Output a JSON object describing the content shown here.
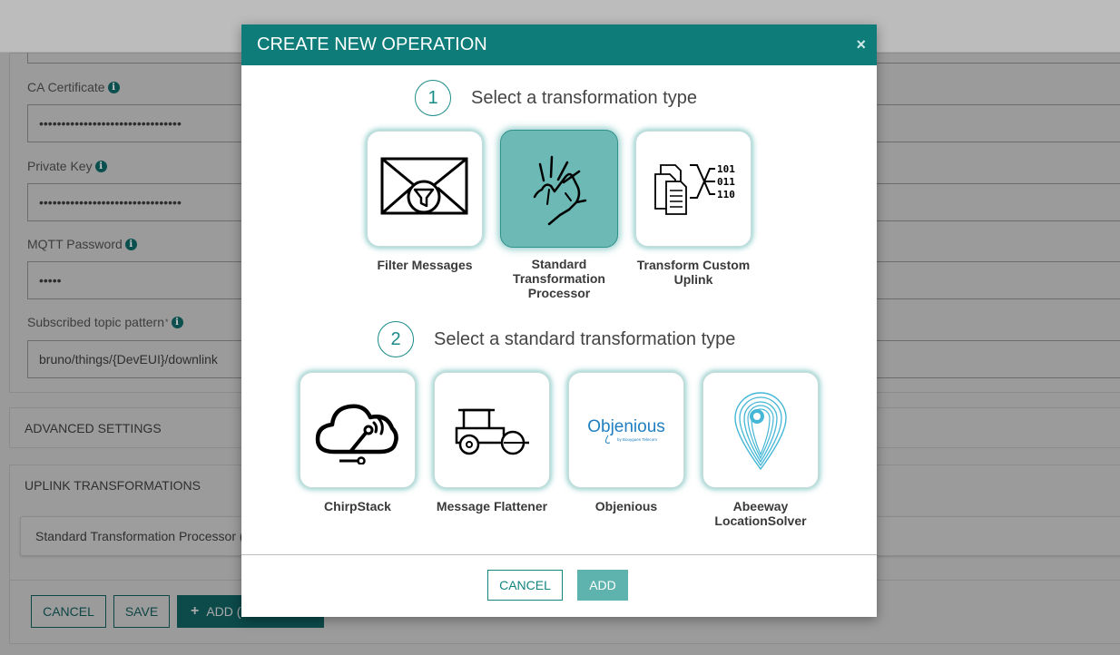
{
  "background": {
    "fields": [
      {
        "label": "CA Certificate",
        "value": "••••••••••••••••••••••••••••••••",
        "required": false
      },
      {
        "label": "Private Key",
        "value": "••••••••••••••••••••••••••••••••",
        "required": false
      },
      {
        "label": "MQTT Password",
        "value": "•••••",
        "required": false
      },
      {
        "label": "Subscribed topic pattern",
        "value": "bruno/things/{DevEUI}/downlink",
        "required": true
      }
    ],
    "required_marker": "*",
    "info_icon": "i",
    "advanced_settings": "ADVANCED SETTINGS",
    "uplink_transformations": "UPLINK TRANSFORMATIONS",
    "processor_card": "Standard Transformation Processor (",
    "buttons": {
      "cancel": "CANCEL",
      "save": "SAVE",
      "add": "ADD (",
      "add_icon": "+"
    }
  },
  "modal": {
    "title": "CREATE NEW OPERATION",
    "close": "×",
    "step1": {
      "number": "1",
      "text": "Select a transformation type"
    },
    "transformation_types": [
      {
        "label": "Filter Messages",
        "icon": "envelope-filter-icon",
        "selected": false
      },
      {
        "label": "Standard Transformation Processor",
        "icon": "finger-tap-icon",
        "selected": true
      },
      {
        "label": "Transform Custom Uplink",
        "icon": "documents-binary-icon",
        "selected": false
      }
    ],
    "binary_lines": [
      "101",
      "011",
      "110"
    ],
    "step2": {
      "number": "2",
      "text": "Select a standard transformation type"
    },
    "standard_types": [
      {
        "label": "ChirpStack",
        "icon": "cloud-network-icon",
        "selected": false
      },
      {
        "label": "Message Flattener",
        "icon": "road-roller-icon",
        "selected": false
      },
      {
        "label": "Objenious",
        "icon": "objenious-logo",
        "selected": false
      },
      {
        "label": "Abeeway LocationSolver",
        "icon": "location-pin-icon",
        "selected": false
      }
    ],
    "objenious_logo_text": "Objenious",
    "objenious_logo_sub": "by Bouygues Telecom",
    "cancel_label": "CANCEL",
    "add_label": "ADD"
  },
  "colors": {
    "accent": "#0e7d7a",
    "selected_tile": "#6db9b5",
    "add_button": "#5fb3ae"
  }
}
